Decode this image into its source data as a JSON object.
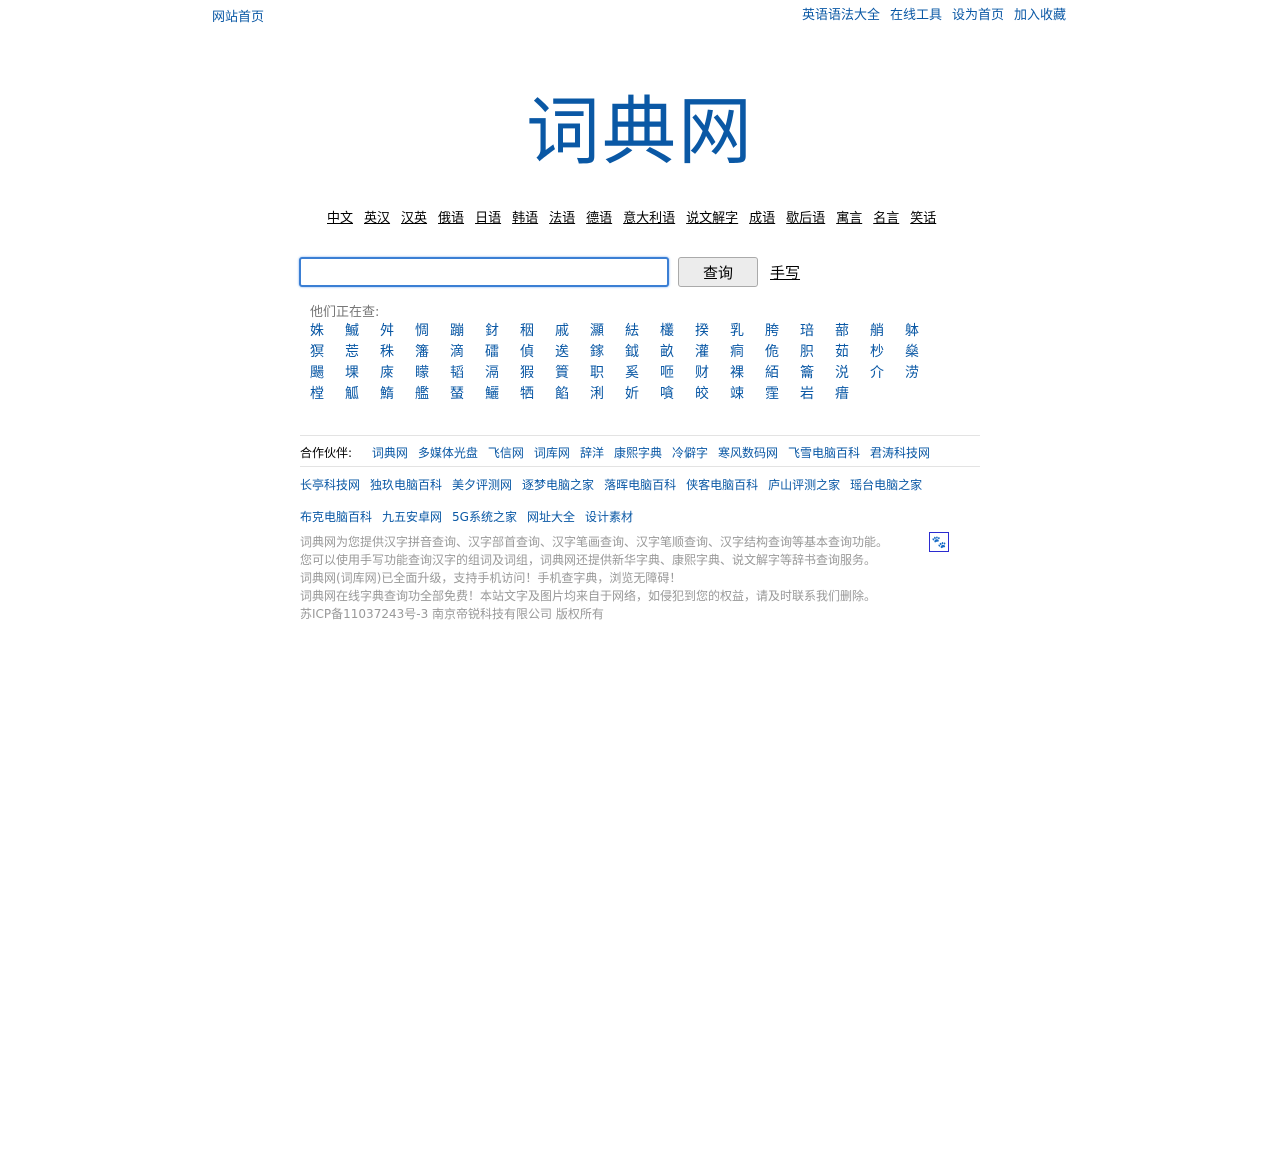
{
  "topbar": {
    "home": "网站首页",
    "links": [
      "英语语法大全",
      "在线工具",
      "设为首页",
      "加入收藏"
    ]
  },
  "logo": "词典网",
  "langs": [
    "中文",
    "英汉",
    "汉英",
    "俄语",
    "日语",
    "韩语",
    "法语",
    "德语",
    "意大利语",
    "说文解字",
    "成语",
    "歇后语",
    "寓言",
    "名言",
    "笑话"
  ],
  "search": {
    "value": "",
    "button": "查询",
    "handwrite": "手写"
  },
  "watching": {
    "label": "他们正在查:",
    "chars": [
      "姝",
      "鰄",
      "舛",
      "惆",
      "蹦",
      "釮",
      "秵",
      "戚",
      "灦",
      "紶",
      "欉",
      "揆",
      "乳",
      "胯",
      "琣",
      "蔀",
      "艄",
      "躰",
      "猽",
      "莣",
      "秼",
      "籓",
      "滴",
      "礌",
      "偵",
      "逘",
      "鎵",
      "鉞",
      "畝",
      "灌",
      "痌",
      "佹",
      "胑",
      "茹",
      "杪",
      "燊",
      "颺",
      "堁",
      "庲",
      "矇",
      "韬",
      "滆",
      "猳",
      "篢",
      "职",
      "奚",
      "咂",
      "财",
      "裸",
      "絔",
      "籥",
      "涚",
      "介",
      "涝",
      "樘",
      "觚",
      "鰖",
      "艦",
      "蝅",
      "鱺",
      "牺",
      "餡",
      "浰",
      "妡",
      "嗿",
      "皎",
      "竦",
      "霔",
      "岩",
      "瘄"
    ]
  },
  "partners": {
    "label": "合作伙伴:",
    "row1": [
      "词典网",
      "多媒体光盘",
      "飞信网",
      "词库网",
      "辞洋",
      "康熙字典",
      "冷僻字",
      "寒风数码网",
      "飞雪电脑百科",
      "君涛科技网"
    ],
    "row2": [
      "长亭科技网",
      "独玖电脑百科",
      "美夕评测网",
      "逐梦电脑之家",
      "落晖电脑百科",
      "侠客电脑百科",
      "庐山评测之家",
      "瑶台电脑之家"
    ],
    "row3": [
      "布克电脑百科",
      "九五安卓网",
      "5G系统之家",
      "网址大全",
      "设计素材"
    ]
  },
  "footer": {
    "lines": [
      "词典网为您提供汉字拼音查询、汉字部首查询、汉字笔画查询、汉字笔顺查询、汉字结构查询等基本查询功能。",
      "您可以使用手写功能查询汉字的组词及词组，词典网还提供新华字典、康熙字典、说文解字等辞书查询服务。",
      "词典网(词库网)已全面升级，支持手机访问！手机查字典，浏览无障碍！",
      "词典网在线字典查询功全部免费！本站文字及图片均来自于网络，如侵犯到您的权益，请及时联系我们删除。",
      "苏ICP备11037243号-3   南京帝锐科技有限公司 版权所有"
    ]
  },
  "icons": {
    "baidu": "paw-icon"
  }
}
